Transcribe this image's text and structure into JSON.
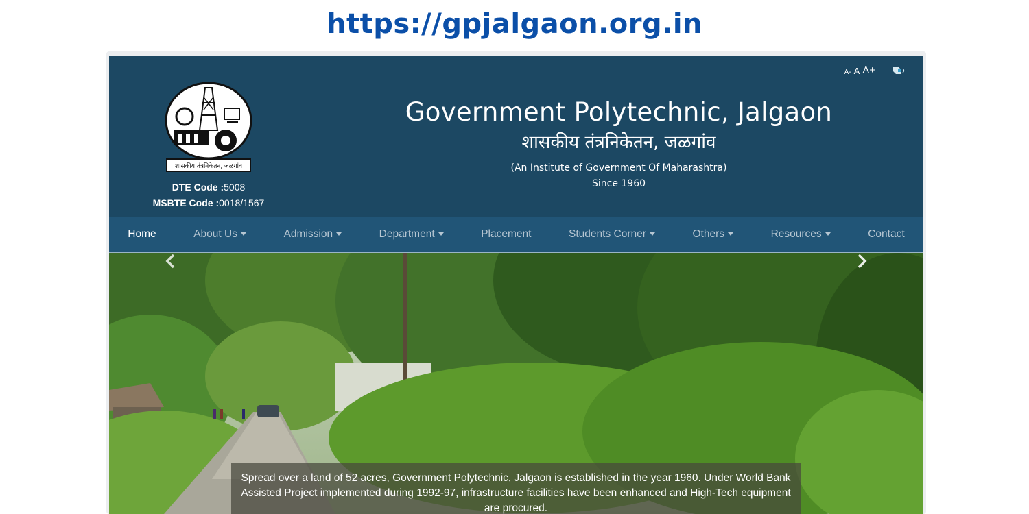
{
  "banner": {
    "url": "https://gpjalgaon.org.in"
  },
  "accessibility": {
    "decrease": "A-",
    "normal": "A",
    "increase": "A+",
    "speaker_icon": "speaker-icon"
  },
  "header": {
    "logo_caption": "शासकीय तंत्रनिकेतन, जळगांव",
    "dte_label": "DTE Code :",
    "dte_value": "5008",
    "msbte_label": "MSBTE Code :",
    "msbte_value": "0018/1567",
    "title_en": "Government Polytechnic, Jalgaon",
    "title_mr": "शासकीय तंत्रनिकेतन, जळगांव",
    "subtitle": "(An Institute of Government Of Maharashtra)",
    "since": "Since 1960"
  },
  "nav": {
    "items": [
      {
        "label": "Home",
        "dropdown": false,
        "active": true
      },
      {
        "label": "About Us",
        "dropdown": true,
        "active": false
      },
      {
        "label": "Admission",
        "dropdown": true,
        "active": false
      },
      {
        "label": "Department",
        "dropdown": true,
        "active": false
      },
      {
        "label": "Placement",
        "dropdown": false,
        "active": false
      },
      {
        "label": "Students Corner",
        "dropdown": true,
        "active": false
      },
      {
        "label": "Others",
        "dropdown": true,
        "active": false
      },
      {
        "label": "Resources",
        "dropdown": true,
        "active": false
      },
      {
        "label": "Contact",
        "dropdown": false,
        "active": false
      }
    ]
  },
  "carousel": {
    "caption": "Spread over a land of 52 acres, Government Polytechnic, Jalgaon is established in the year 1960. Under World Bank Assisted Project implemented during 1992-97, infrastructure facilities have been enhanced and High-Tech equipment are procured.",
    "prev_icon": "chevron-left-icon",
    "next_icon": "chevron-right-icon"
  },
  "colors": {
    "header_bg": "#1c4863",
    "nav_bg": "#215577",
    "banner_text": "#0b4fa8"
  }
}
